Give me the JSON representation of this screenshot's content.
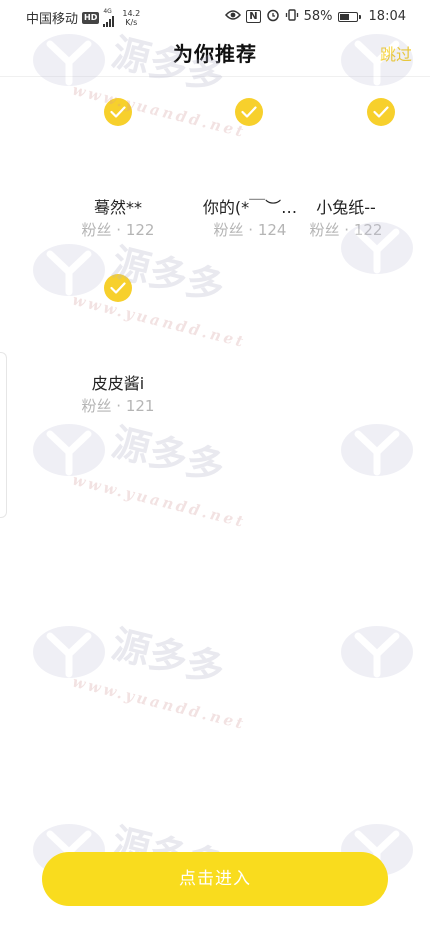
{
  "status_bar": {
    "carrier": "中国移动",
    "hd": "HD",
    "network": "4G",
    "speed_value": "14.2",
    "speed_unit": "K/s",
    "nfc": "N",
    "battery_percent": "58%",
    "battery_level": 0.58,
    "time": "18:04"
  },
  "header": {
    "title": "为你推荐",
    "skip_label": "跳过"
  },
  "users": [
    {
      "name": "蓦然**",
      "fans": "粉丝 · 122",
      "checked": true
    },
    {
      "name": "你的(*￣︶…",
      "fans": "粉丝 · 124",
      "checked": true
    },
    {
      "name": "小兔纸--",
      "fans": "粉丝 · 122",
      "checked": true
    },
    {
      "name": "皮皮酱i",
      "fans": "粉丝 · 121",
      "checked": true
    }
  ],
  "enter_button": {
    "label": "点击进入"
  },
  "watermark": {
    "text_cn": "源多多",
    "text_en": "www.yuandd.net"
  },
  "colors": {
    "accent": "#f9dc1e",
    "check": "#f7d02c",
    "skip": "#f4c700",
    "muted": "#b5b5b5"
  }
}
